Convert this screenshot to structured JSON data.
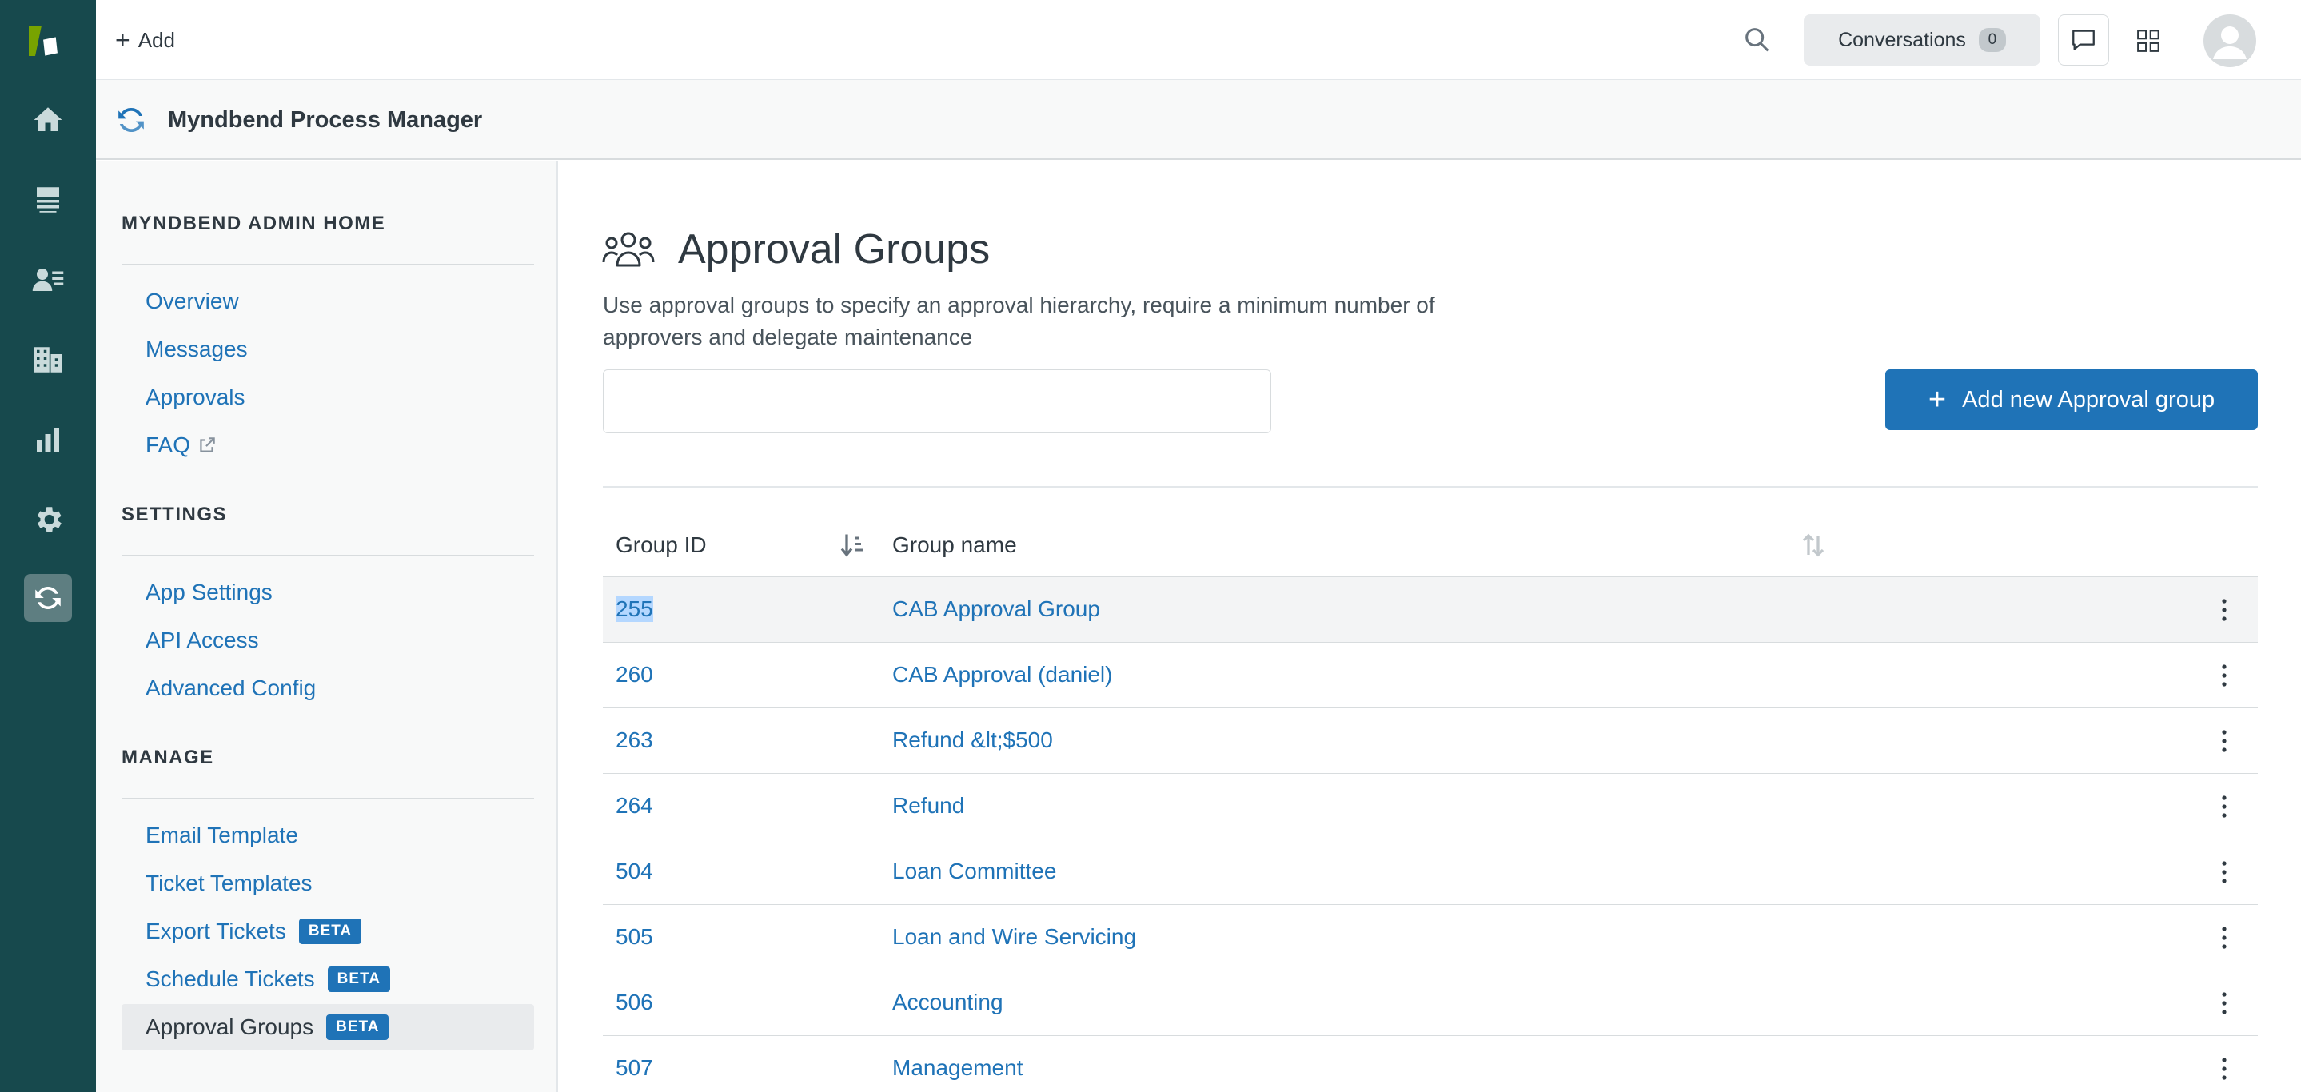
{
  "topbar": {
    "add_label": "Add",
    "conversations_label": "Conversations",
    "conversations_count": "0"
  },
  "rail": {
    "icons": [
      "zendesk-logo",
      "home-icon",
      "views-icon",
      "customers-icon",
      "organizations-icon",
      "reporting-icon",
      "admin-gear-icon",
      "process-manager-icon"
    ]
  },
  "app": {
    "title": "Myndbend Process Manager"
  },
  "sidebar": {
    "section_home": "MYNDBEND ADMIN HOME",
    "home_links": [
      {
        "label": "Overview"
      },
      {
        "label": "Messages"
      },
      {
        "label": "Approvals"
      },
      {
        "label": "FAQ"
      }
    ],
    "section_settings": "SETTINGS",
    "settings_links": [
      {
        "label": "App Settings"
      },
      {
        "label": "API Access"
      },
      {
        "label": "Advanced Config"
      }
    ],
    "section_manage": "MANAGE",
    "manage_links": [
      {
        "label": "Email Template"
      },
      {
        "label": "Ticket Templates"
      },
      {
        "label": "Export Tickets",
        "badge": "BETA"
      },
      {
        "label": "Schedule Tickets",
        "badge": "BETA"
      },
      {
        "label": "Approval Groups",
        "badge": "BETA"
      }
    ]
  },
  "main": {
    "title": "Approval Groups",
    "description": "Use approval groups to specify an approval hierarchy, require a minimum number of approvers and delegate maintenance",
    "search_value": "",
    "add_button_label": "Add new Approval group",
    "table": {
      "col_id": "Group ID",
      "col_name": "Group name",
      "rows": [
        {
          "id": "255",
          "name": "CAB Approval Group"
        },
        {
          "id": "260",
          "name": "CAB Approval (daniel)"
        },
        {
          "id": "263",
          "name": "Refund &lt;$500"
        },
        {
          "id": "264",
          "name": "Refund"
        },
        {
          "id": "504",
          "name": "Loan Committee"
        },
        {
          "id": "505",
          "name": "Loan and Wire Servicing"
        },
        {
          "id": "506",
          "name": "Accounting"
        },
        {
          "id": "507",
          "name": "Management"
        }
      ]
    }
  },
  "colors": {
    "rail": "#17494d",
    "link": "#1f73b7",
    "primary": "#1f73b7",
    "text": "#2f3941"
  }
}
